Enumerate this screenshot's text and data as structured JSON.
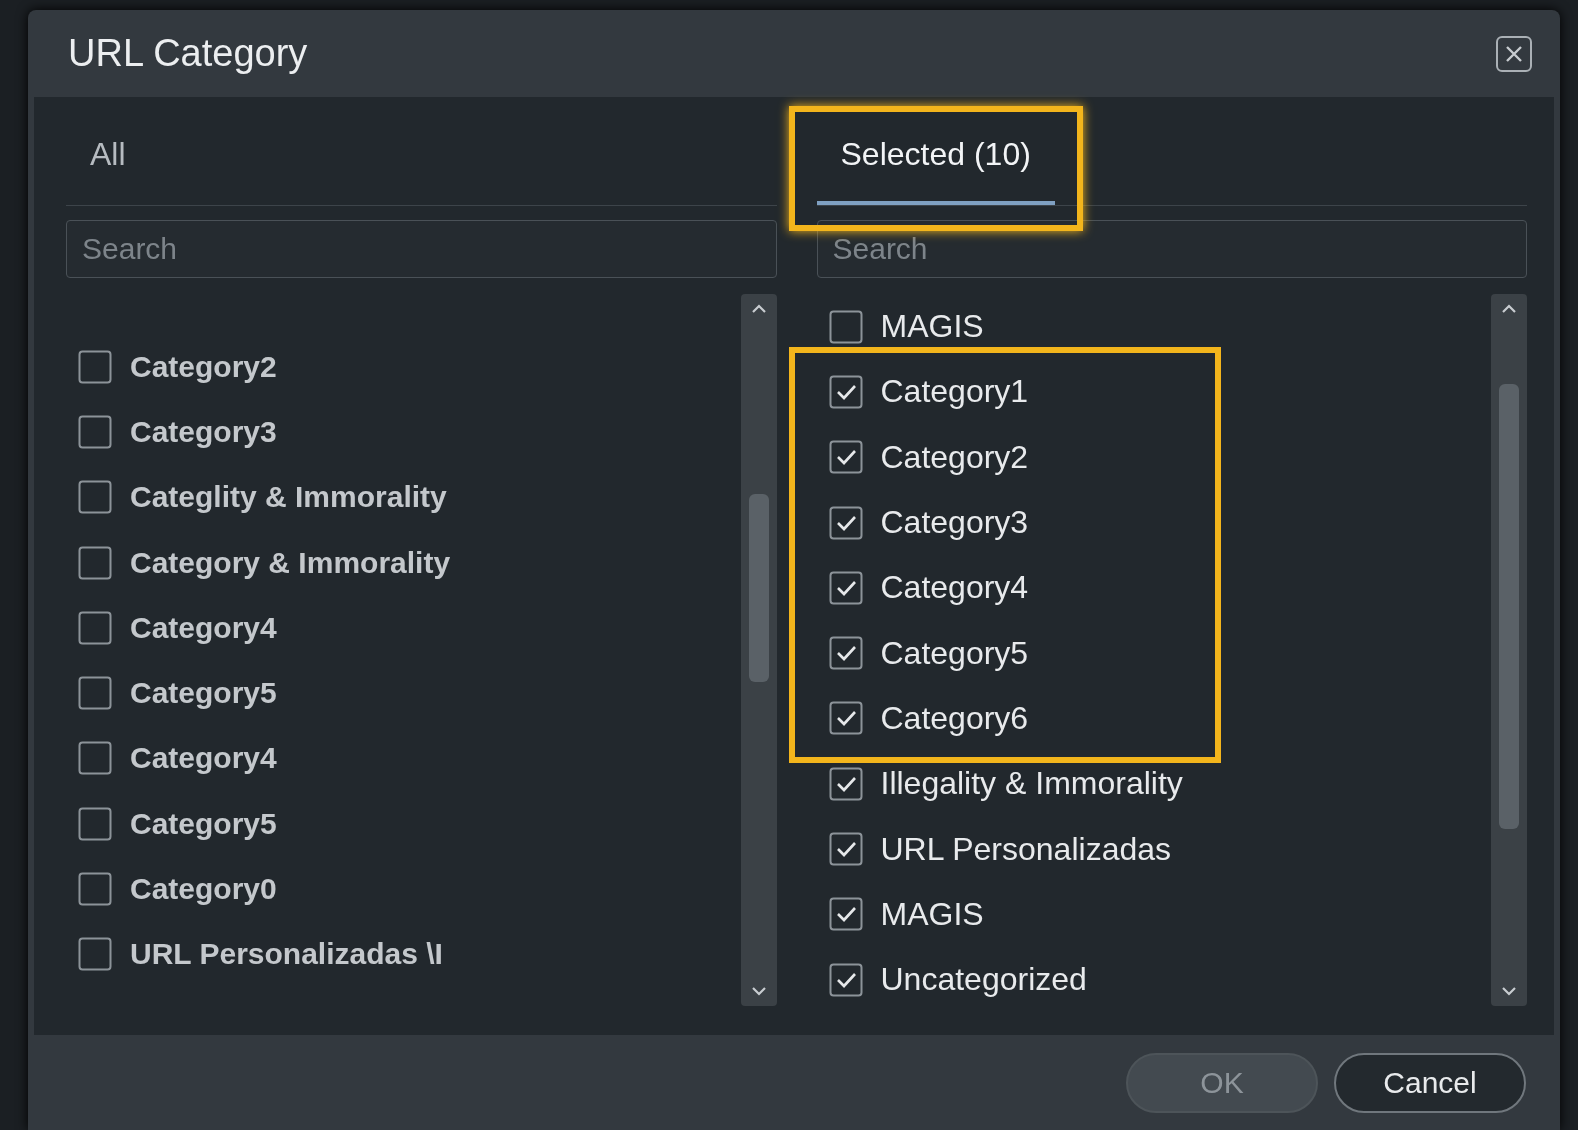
{
  "dialog": {
    "title": "URL Category"
  },
  "tabs": [
    {
      "label": "All",
      "selected": false,
      "highlighted": false
    },
    {
      "label": "Selected (10)",
      "selected": true,
      "highlighted": true
    }
  ],
  "panes": [
    {
      "search": {
        "placeholder": "Search"
      },
      "items": [
        {
          "label": "Category2",
          "checked": false
        },
        {
          "label": "Category3",
          "checked": false
        },
        {
          "label": "Categlity & Immorality",
          "checked": false
        },
        {
          "label": "Category & Immorality",
          "checked": false
        },
        {
          "label": "Category4",
          "checked": false
        },
        {
          "label": "Category5",
          "checked": false
        },
        {
          "label": "Category4",
          "checked": false
        },
        {
          "label": "Category5",
          "checked": false
        },
        {
          "label": "Category0",
          "checked": false
        },
        {
          "label": "URL Personalizadas \\I",
          "checked": false
        }
      ]
    },
    {
      "search": {
        "placeholder": "Search"
      },
      "items": [
        {
          "label": "MAGIS",
          "checked": false,
          "highlighted": false
        },
        {
          "label": "Category1",
          "checked": true,
          "highlighted": true
        },
        {
          "label": "Category2",
          "checked": true,
          "highlighted": true
        },
        {
          "label": "Category3",
          "checked": true,
          "highlighted": true
        },
        {
          "label": "Category4",
          "checked": true,
          "highlighted": true
        },
        {
          "label": "Category5",
          "checked": true,
          "highlighted": true
        },
        {
          "label": "Category6",
          "checked": true,
          "highlighted": true
        },
        {
          "label": "Illegality & Immorality",
          "checked": true,
          "highlighted": false
        },
        {
          "label": "URL Personalizadas",
          "checked": true,
          "highlighted": false
        },
        {
          "label": "MAGIS",
          "checked": true,
          "highlighted": false
        },
        {
          "label": "Uncategorized",
          "checked": true,
          "highlighted": false
        }
      ]
    }
  ],
  "buttons": [
    {
      "label": "OK",
      "disabled": true
    },
    {
      "label": "Cancel",
      "disabled": false
    }
  ]
}
